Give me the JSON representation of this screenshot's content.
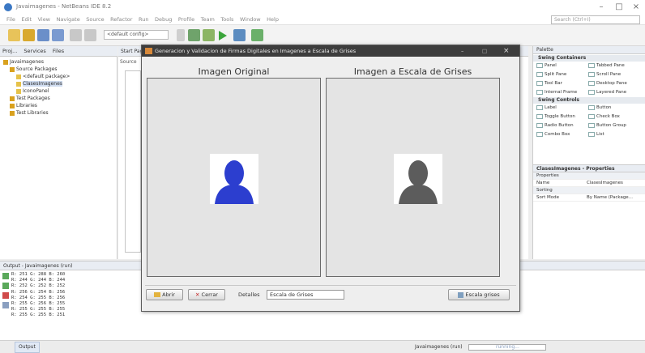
{
  "ide": {
    "window_title": "Javaimagenes - NetBeans IDE 8.2",
    "menu": [
      "File",
      "Edit",
      "View",
      "Navigate",
      "Source",
      "Refactor",
      "Run",
      "Debug",
      "Profile",
      "Team",
      "Tools",
      "Window",
      "Help"
    ],
    "search_placeholder": "Search (Ctrl+I)",
    "config_select": "<default config>",
    "left_tabs": [
      "Proj...",
      "Services",
      "Files"
    ],
    "tree": [
      {
        "label": "Javaimagenes",
        "level": 0,
        "color": "#d9a11e"
      },
      {
        "label": "Source Packages",
        "level": 1,
        "color": "#d9a11e"
      },
      {
        "label": "<default package>",
        "level": 2,
        "color": "#e6c24a"
      },
      {
        "label": "ClasesImagenes",
        "level": 2,
        "color": "#e6c24a",
        "selected": true
      },
      {
        "label": "IconoPanel",
        "level": 2,
        "color": "#e6c24a"
      },
      {
        "label": "Test Packages",
        "level": 1,
        "color": "#d9a11e"
      },
      {
        "label": "Libraries",
        "level": 1,
        "color": "#d9a11e"
      },
      {
        "label": "Test Libraries",
        "level": 1,
        "color": "#d9a11e"
      }
    ],
    "editor_tabs": [
      "Start Pag",
      "Source"
    ],
    "palette_title": "Palette",
    "palette_sections": [
      {
        "title": "Swing Containers",
        "items": [
          [
            "Panel",
            "Tabbed Pane"
          ],
          [
            "Split Pane",
            "Scroll Pane"
          ],
          [
            "Tool Bar",
            "Desktop Pane"
          ],
          [
            "Internal Frame",
            "Layered Pane"
          ]
        ]
      },
      {
        "title": "Swing Controls",
        "items": [
          [
            "Label",
            "Button"
          ],
          [
            "Toggle Button",
            "Check Box"
          ],
          [
            "Radio Button",
            "Button Group"
          ],
          [
            "Combo Box",
            "List"
          ]
        ]
      }
    ],
    "props_title": "ClasesImagenes - Properties",
    "props_section": "Properties",
    "props_rows": [
      [
        "Name",
        "ClasesImagenes"
      ]
    ],
    "props_section2": "Sorting",
    "props_rows2": [
      [
        "Sort Mode",
        "By Name (Package..."
      ]
    ],
    "output_title": "Output - Javaimagenes (run)",
    "output_lines": [
      "R: 251 G: 288 B: 260",
      "R: 244 G: 244 B: 244",
      "R: 252 G: 252 B: 252",
      "R: 256 G: 254 B: 256",
      "R: 254 G: 255 B: 256",
      "R: 255 G: 256 B: 255",
      "R: 255 G: 255 B: 255",
      "R: 255 G: 255 B: 251"
    ],
    "status_tab": "Output",
    "status_project": "Javaimagenes (run)",
    "status_running": "running..."
  },
  "dialog": {
    "title": "Generacion y Validacion de Firmas Digitales en Imagenes a Escala de Grises",
    "left_label": "Imagen Original",
    "right_label": "Imagen a Escala de Grises",
    "open_button": "Abrir",
    "close_button": "Cerrar",
    "details_label": "Detalles",
    "details_value": "Escala de Grises",
    "gray_button": "Escala grises"
  },
  "colors": {
    "avatar_original": "#2c3ecf",
    "avatar_gray": "#5c5c5c",
    "dialog_title_bg": "#3d3d3d"
  }
}
